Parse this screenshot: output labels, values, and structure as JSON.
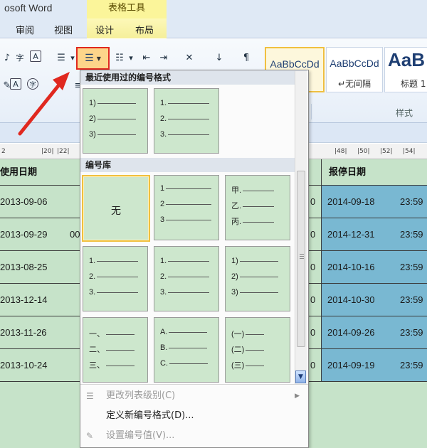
{
  "app": {
    "title": "osoft Word"
  },
  "ribbon_tabs": {
    "context_header": "表格工具",
    "review": "审阅",
    "view": "视图",
    "design": "设计",
    "layout": "布局"
  },
  "style_gallery": {
    "normal_sample": "AaBbCcDd",
    "nospacing_sample": "AaBbCcDd",
    "nospacing_name": "↵无间隔",
    "heading_sample": "AaB",
    "heading_name": "标题 1",
    "group_label": "样式"
  },
  "ruler_marks": [
    "2",
    "|20|",
    "|22|",
    "|48|",
    "|50|",
    "|52|",
    "|54|"
  ],
  "table": {
    "headers": {
      "use_date": "使用日期",
      "warranty_date": "报停日期"
    },
    "rows": [
      {
        "use_date": "2013-09-06",
        "mid": "",
        "warranty_date": "2014-09-18",
        "time": "23:59"
      },
      {
        "use_date": "2013-09-29",
        "mid": "00",
        "warranty_date": "2014-12-31",
        "time": "23:59"
      },
      {
        "use_date": "2013-08-25",
        "mid": "",
        "warranty_date": "2014-10-16",
        "time": "23:59"
      },
      {
        "use_date": "2013-12-14",
        "mid": "",
        "warranty_date": "2014-10-30",
        "time": "23:59"
      },
      {
        "use_date": "2013-11-26",
        "mid": "",
        "warranty_date": "2014-09-26",
        "time": "23:59"
      },
      {
        "use_date": "2013-10-24",
        "mid": "",
        "warranty_date": "2014-09-19",
        "time": "23:59"
      }
    ],
    "trailing_digit": "0"
  },
  "numbering_menu": {
    "recent_title": "最近使用过的编号格式",
    "library_title": "编号库",
    "recent_formats": [
      {
        "labels": [
          "1)",
          "2)",
          "3)"
        ]
      },
      {
        "labels": [
          "1.",
          "2.",
          "3."
        ]
      }
    ],
    "none_label": "无",
    "library_formats": [
      {
        "labels": [
          "1",
          "2",
          "3"
        ]
      },
      {
        "labels": [
          "甲.",
          "乙.",
          "丙."
        ]
      },
      {
        "labels": [
          "1.",
          "2.",
          "3."
        ]
      },
      {
        "labels": [
          "1.",
          "2.",
          "3."
        ]
      },
      {
        "labels": [
          "1)",
          "2)",
          "3)"
        ]
      },
      {
        "labels": [
          "一、",
          "二、",
          "三、"
        ]
      },
      {
        "labels": [
          "A.",
          "B.",
          "C."
        ]
      },
      {
        "labels": [
          "(一)",
          "(二)",
          "(三)"
        ]
      }
    ],
    "change_level": "更改列表级别(C)",
    "define_new": "定义新编号格式(D)...",
    "set_value": "设置编号值(V)..."
  },
  "colors": {
    "accent_red": "#e0281f",
    "highlight": "#f0c040",
    "table_green": "#c6e3c9",
    "table_blue": "#79b8d2"
  }
}
